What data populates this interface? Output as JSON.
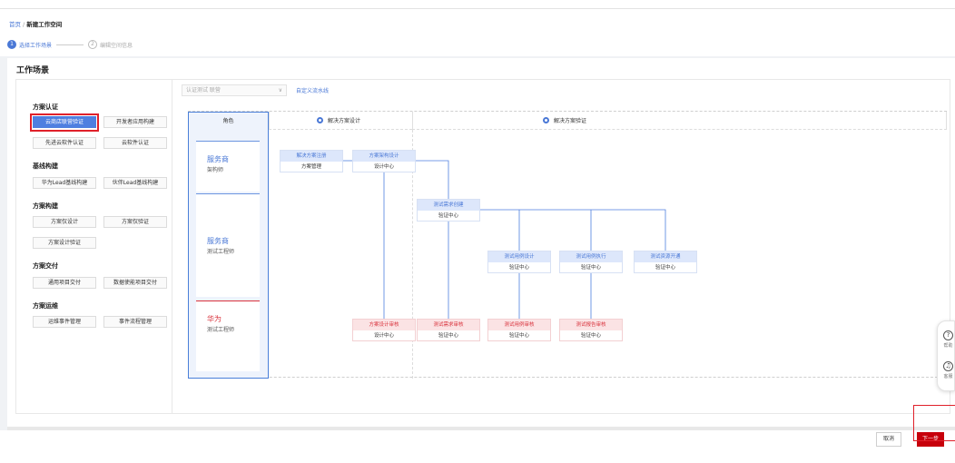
{
  "breadcrumb": {
    "home": "首页",
    "sep": "/",
    "current": "新建工作空间"
  },
  "steps": [
    {
      "num": "1",
      "label": "选择工作场景"
    },
    {
      "num": "2",
      "label": "编辑空间信息"
    }
  ],
  "section_title": "工作场景",
  "categories": [
    {
      "title": "方案认证",
      "items": [
        "云商店联营验证",
        "开发者应用构建",
        "先进云软件认证",
        "云软件认证"
      ]
    },
    {
      "title": "基线构建",
      "items": [
        "华为Lead基线构建",
        "伙伴Lead基线构建"
      ]
    },
    {
      "title": "方案构建",
      "items": [
        "方案仅设计",
        "方案仅验证",
        "方案设计验证"
      ]
    },
    {
      "title": "方案交付",
      "items": [
        "通用项目交付",
        "数据使能项目交付"
      ]
    },
    {
      "title": "方案运维",
      "items": [
        "运维事件管理",
        "事件流程管理"
      ]
    }
  ],
  "filter": {
    "placeholder": "认证测试 联营",
    "chevron": "∨"
  },
  "custom_flow_link": "自定义流水线",
  "diagram": {
    "roles_header": "角色",
    "roles": [
      {
        "name": "服务商",
        "sub": "架构师"
      },
      {
        "name": "服务商",
        "sub": "测试工程师"
      },
      {
        "name": "华为",
        "sub": "测试工程师"
      }
    ],
    "phases": [
      "解决方案设计",
      "解决方案验证"
    ],
    "nodes": {
      "n1": {
        "title": "解决方案注册",
        "sub": "方案管理"
      },
      "n2": {
        "title": "方案架构设计",
        "sub": "设计中心"
      },
      "n3": {
        "title": "测试需求创建",
        "sub": "验证中心"
      },
      "n4": {
        "title": "测试用例设计",
        "sub": "验证中心"
      },
      "n5": {
        "title": "测试用例执行",
        "sub": "验证中心"
      },
      "n6": {
        "title": "测试资源开通",
        "sub": "验证中心"
      },
      "n7": {
        "title": "方案设计审核",
        "sub": "设计中心"
      },
      "n8": {
        "title": "测试需求审核",
        "sub": "验证中心"
      },
      "n9": {
        "title": "测试用例审核",
        "sub": "验证中心"
      },
      "n10": {
        "title": "测试报告审核",
        "sub": "验证中心"
      }
    }
  },
  "float_help": [
    {
      "icon": "?",
      "label": "帮助"
    },
    {
      "icon": "♫",
      "label": "客服"
    }
  ],
  "footer": {
    "cancel": "取消",
    "next": "下一步"
  },
  "colors": {
    "accent": "#4a78d6",
    "primary_button": "#c7000b",
    "highlight": "#e0202a",
    "audit_red": "#d9323c"
  }
}
